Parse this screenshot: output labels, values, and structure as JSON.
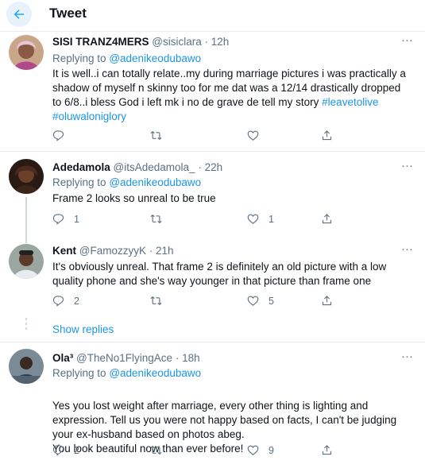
{
  "header": {
    "title": "Tweet"
  },
  "tweets": [
    {
      "name": "SISI TRANZ4MERS",
      "handle": "@sisiclara",
      "dot": "·",
      "time": "12h",
      "reply_prefix": "Replying to",
      "reply_to": "@adenikeodubawo",
      "text": "It is well..i can totally relate..my during marriage pictures i was practically a shadow of myself n skinny too for me dat was a 12/14 drastically dropped to 6/8..i bless God i left mk i no de grave de tell my story",
      "hashtags": [
        "#leavetolive",
        "#oluwaloniglory"
      ],
      "replies": "",
      "retweets": "",
      "likes": ""
    },
    {
      "name": "Adedamola",
      "handle": "@itsAdedamola_",
      "dot": "·",
      "time": "22h",
      "reply_prefix": "Replying to",
      "reply_to": "@adenikeodubawo",
      "text": "Frame 2 looks so unreal to be true",
      "replies": "1",
      "retweets": "",
      "likes": "1"
    },
    {
      "name": "Kent",
      "handle": "@FamozzyyK",
      "dot": "·",
      "time": "21h",
      "text": "It's obviously unreal. That frame 2 is definitely an old picture with a low quality phone and she's way younger in that picture than frame one",
      "replies": "2",
      "retweets": "",
      "likes": "5"
    },
    {
      "name": "Ola³",
      "handle": "@TheNo1FlyingAce",
      "dot": "·",
      "time": "18h",
      "reply_prefix": "Replying to",
      "reply_to": "@adenikeodubawo",
      "text": "Yes you lost weight after marriage, every other thing is lighting and expression. Tell us you were not happy based on facts, I can't be judging your ex-husband based on photos abeg.\nYou look beautiful now than ever before!",
      "replies": "2",
      "retweets": "",
      "likes": "9"
    }
  ],
  "show_replies": "Show replies",
  "icons": {
    "back": "arrow-left-icon",
    "more": "more-icon",
    "reply": "reply-icon",
    "retweet": "retweet-icon",
    "like": "heart-icon",
    "share": "share-icon"
  },
  "colors": {
    "accent": "#1da1f2",
    "link": "#1b95e0",
    "muted": "#5b7083",
    "border": "#e6ecf0"
  }
}
